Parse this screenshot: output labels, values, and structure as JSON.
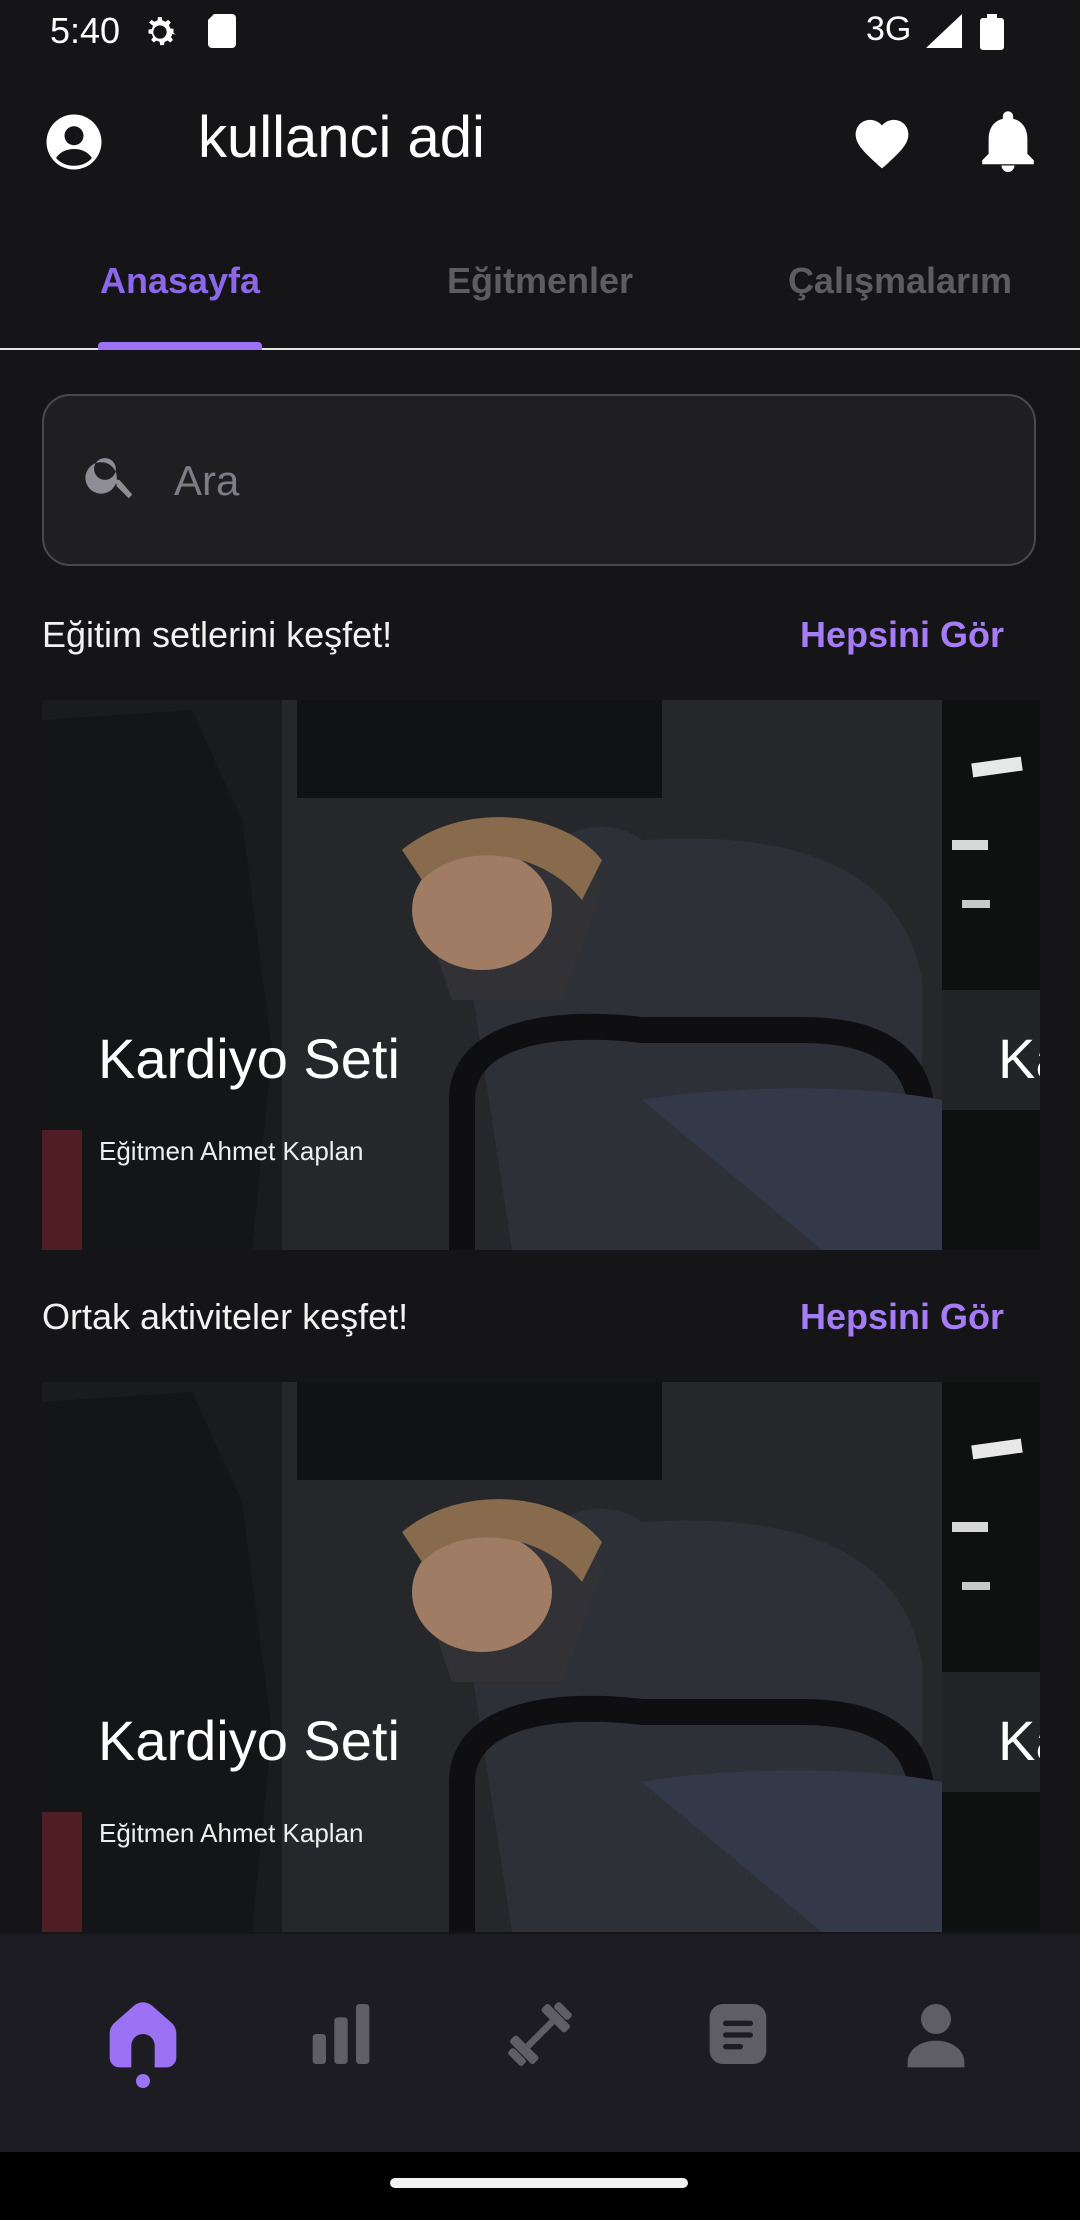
{
  "status": {
    "time": "5:40",
    "network": "3G"
  },
  "header": {
    "username": "kullanci adi"
  },
  "tabs": [
    {
      "label": "Anasayfa",
      "active": true
    },
    {
      "label": "Eğitmenler",
      "active": false
    },
    {
      "label": "Çalışmalarım",
      "active": false
    }
  ],
  "search": {
    "placeholder": "Ara"
  },
  "sections": [
    {
      "title": "Eğitim setlerini keşfet!",
      "see_all": "Hepsini Gör",
      "cards": [
        {
          "title": "Kardiyo Seti",
          "subtitle": "Eğitmen Ahmet Kaplan"
        },
        {
          "title": "Ka"
        }
      ]
    },
    {
      "title": "Ortak aktiviteler keşfet!",
      "see_all": "Hepsini Gör",
      "cards": [
        {
          "title": "Kardiyo Seti",
          "subtitle": "Eğitmen Ahmet Kaplan"
        },
        {
          "title": "Ka"
        }
      ]
    }
  ],
  "bottom_nav": [
    {
      "icon": "home-icon",
      "active": true
    },
    {
      "icon": "bar-chart-icon",
      "active": false
    },
    {
      "icon": "dumbbell-icon",
      "active": false
    },
    {
      "icon": "notes-icon",
      "active": false
    },
    {
      "icon": "person-icon",
      "active": false
    }
  ],
  "colors": {
    "accent": "#9b72f3",
    "background": "#151416",
    "nav_background": "#1d1c22"
  }
}
